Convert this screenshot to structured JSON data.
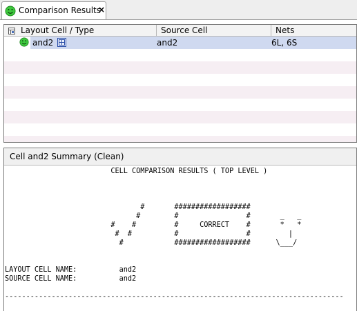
{
  "tab": {
    "title": "Comparison Results",
    "close_glyph": "×",
    "status_icon": "smiley-green-icon"
  },
  "table": {
    "columns": [
      "Layout Cell / Type",
      "Source Cell",
      "Nets"
    ],
    "rows": [
      {
        "status_icon": "smiley-green-icon",
        "layout_cell": "and2",
        "type_icon": "cell-layout-icon",
        "source_cell": "and2",
        "nets": "6L, 6S"
      }
    ]
  },
  "summary": {
    "title": "Cell and2 Summary (Clean)",
    "report_text": "                         CELL COMPARISON RESULTS ( TOP LEVEL )\n\n\n\n                                #       ##################\n                               #        #                #       _   _\n                         #    #         #     CORRECT    #       *   *\n                          #  #          #                #         |\n                           #            ##################      \\___/\n\n\nLAYOUT CELL NAME:          and2\nSOURCE CELL NAME:          and2\n\n--------------------------------------------------------------------------------"
  },
  "colors": {
    "selection": "#cfd9f0",
    "alt_row": "#f6eef3",
    "smiley": "#3ec83e"
  }
}
